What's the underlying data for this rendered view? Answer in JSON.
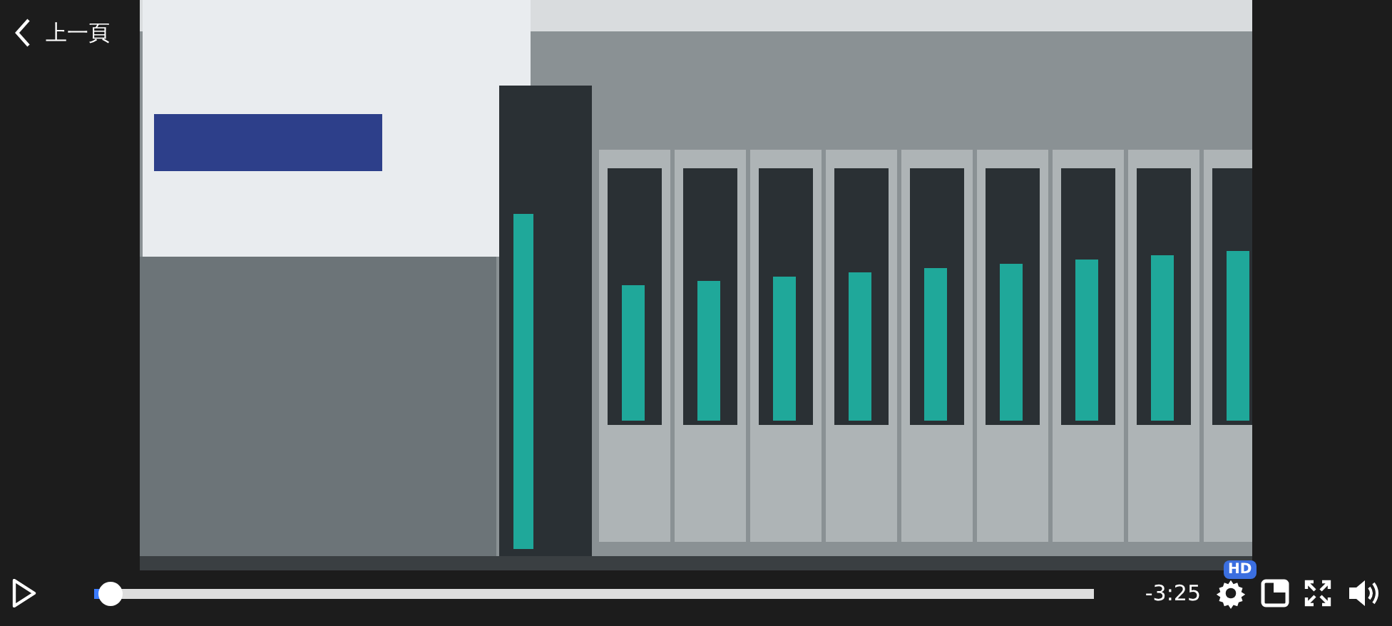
{
  "back": {
    "label": "上一頁"
  },
  "player": {
    "progress": {
      "level": 0.015
    },
    "time": "-3:25",
    "quality_badge": "HD"
  }
}
